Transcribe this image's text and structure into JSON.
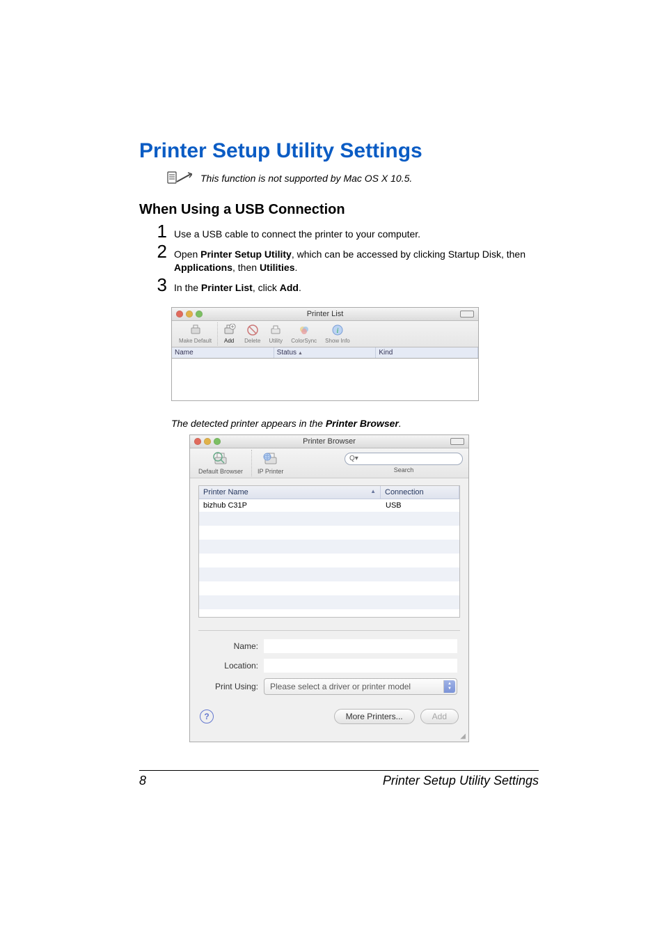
{
  "heading": "Printer Setup Utility Settings",
  "note": "This function is not supported by Mac OS X 10.5.",
  "subheading": "When Using a USB Connection",
  "steps": {
    "s1": {
      "num": "1",
      "text": "Use a USB cable to connect the printer to your computer."
    },
    "s2": {
      "num": "2",
      "pre": "Open ",
      "b1": "Printer Setup Utility",
      "mid1": ", which can be accessed by clicking Startup Disk, then ",
      "b2": "Applications",
      "mid2": ", then ",
      "b3": "Utilities",
      "end": "."
    },
    "s3": {
      "num": "3",
      "pre": "In the ",
      "b1": "Printer List",
      "mid": ", click ",
      "b2": "Add",
      "end": "."
    }
  },
  "win1": {
    "title": "Printer List",
    "toolbar": {
      "makeDefault": "Make Default",
      "add": "Add",
      "delete": "Delete",
      "utility": "Utility",
      "colorsync": "ColorSync",
      "showInfo": "Show Info"
    },
    "columns": {
      "name": "Name",
      "status": "Status",
      "kind": "Kind"
    }
  },
  "caption": {
    "pre": "The detected printer appears in the ",
    "b": "Printer Browser",
    "end": "."
  },
  "win2": {
    "title": "Printer Browser",
    "modes": {
      "default": "Default Browser",
      "ip": "IP Printer"
    },
    "searchGlyph": "Q▾",
    "searchLabel": "Search",
    "listhead": {
      "name": "Printer Name",
      "conn": "Connection"
    },
    "row": {
      "name": "bizhub C31P",
      "conn": "USB"
    },
    "form": {
      "nameLabel": "Name:",
      "locationLabel": "Location:",
      "printUsingLabel": "Print Using:",
      "printUsingValue": "Please select a driver or printer model"
    },
    "buttons": {
      "more": "More Printers...",
      "add": "Add"
    },
    "help": "?"
  },
  "footer": {
    "page": "8",
    "title": "Printer Setup Utility Settings"
  }
}
